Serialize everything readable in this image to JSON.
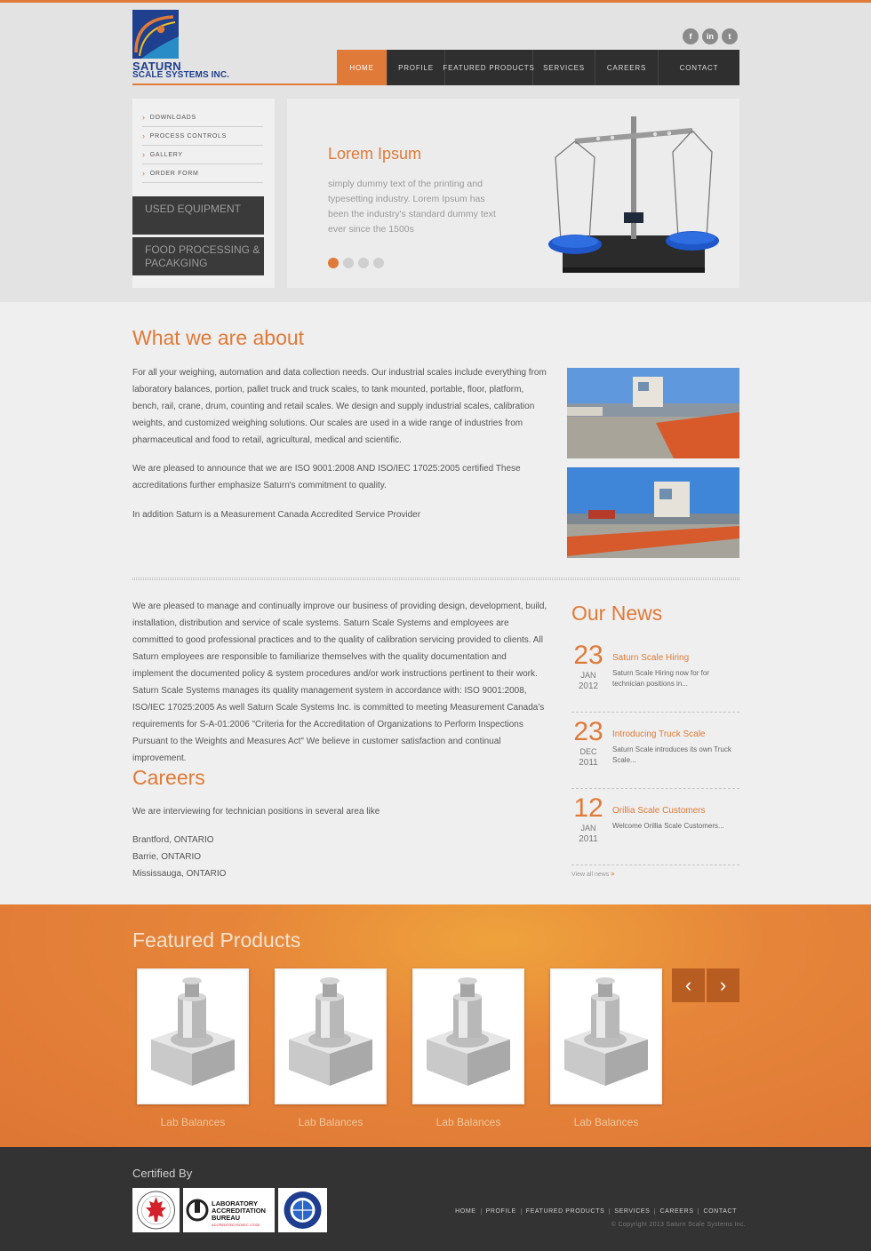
{
  "brand": {
    "name_line1": "SATURN",
    "name_line2": "SCALE SYSTEMS INC.",
    "colors": {
      "accent": "#e07a38",
      "logo_blue": "#1f3f8f",
      "dark": "#2f2f2f"
    }
  },
  "social": [
    {
      "icon": "facebook-icon",
      "glyph": "f"
    },
    {
      "icon": "linkedin-icon",
      "glyph": "in"
    },
    {
      "icon": "twitter-icon",
      "glyph": "t"
    }
  ],
  "nav": {
    "items": [
      "HOME",
      "PROFILE",
      "FEATURED PRODUCTS",
      "SERVICES",
      "CAREERS",
      "CONTACT"
    ],
    "active": "HOME"
  },
  "sidebar": {
    "links": [
      "DOWNLOADS",
      "PROCESS CONTROLS",
      "GALLERY",
      "ORDER FORM"
    ],
    "boxes": [
      "USED EQUIPMENT",
      "FOOD PROCESSING & PACAKGING"
    ]
  },
  "hero": {
    "title": "Lorem Ipsum",
    "text": "simply dummy text of the printing and typesetting industry. Lorem Ipsum has been the industry's standard dummy text ever since the 1500s",
    "slides_total": 4,
    "slide_active": 1
  },
  "about": {
    "title": "What we are about",
    "p1": "For all your weighing, automation and data collection needs. Our industrial scales include everything from laboratory balances, portion, pallet truck and truck scales, to tank mounted, portable, floor, platform, bench, rail, crane, drum, counting and retail scales. We design and supply industrial scales, calibration weights, and customized weighing solutions. Our scales are used in a wide range of industries from pharmaceutical and food to retail, agricultural, medical and scientific.",
    "p2": "We are pleased to announce that we are ISO 9001:2008 AND ISO/IEC 17025:2005 certified These accreditations further emphasize Saturn's commitment to quality.",
    "p3": "In addition Saturn is a Measurement Canada Accredited Service Provider"
  },
  "quality": {
    "text": "We are pleased to manage and continually improve our business of providing design, development, build, installation, distribution and service of scale systems. Saturn Scale Systems and employees are committed to good professional practices and to the quality of calibration servicing provided to clients. All Saturn employees are responsible to familiarize themselves with the quality documentation and implement the documented policy & system procedures and/or work instructions pertinent to their work. Saturn Scale Systems manages its quality management system in accordance with: ISO 9001:2008, ISO/IEC 17025:2005 As well Saturn Scale Systems Inc. is committed to meeting Measurement Canada's requirements for S-A-01:2006 \"Criteria for the Accreditation of Organizations to Perform Inspections Pursuant to the Weights and Measures Act\" We believe in customer satisfaction and continual improvement."
  },
  "careers": {
    "title": "Careers",
    "intro": "We are interviewing for technician positions in several area like",
    "locations": [
      "Brantford, ONTARIO",
      "Barrie, ONTARIO",
      "Mississauga, ONTARIO"
    ]
  },
  "news": {
    "title": "Our News",
    "items": [
      {
        "day": "23",
        "month": "JAN",
        "year": "2012",
        "headline": "Saturn Scale Hiring",
        "body": "Saturn Scale Hiring now for for technician positions in..."
      },
      {
        "day": "23",
        "month": "DEC",
        "year": "2011",
        "headline": "Introducing Truck Scale",
        "body": "Saturn Scale introduces its own Truck Scale..."
      },
      {
        "day": "12",
        "month": "JAN",
        "year": "2011",
        "headline": "Orillia Scale Customers",
        "body": "Welcome Orillia Scale Customers..."
      }
    ],
    "view_all": "View all news",
    "view_all_arrow": ">"
  },
  "featured": {
    "title": "Featured Products",
    "products": [
      "Lab Balances",
      "Lab Balances",
      "Lab Balances",
      "Lab Balances"
    ],
    "prev_glyph": "‹",
    "next_glyph": "›"
  },
  "footer": {
    "certified_title": "Certified By",
    "cert_logos": {
      "lab_line1": "LABORATORY",
      "lab_line2": "ACCREDITATION",
      "lab_line3": "BUREAU",
      "lab_line4": "ACCREDITED ISO/IEC 17025"
    },
    "nav": [
      "HOME",
      "PROFILE",
      "FEATURED PRODUCTS",
      "SERVICES",
      "CAREERS",
      "CONTACT"
    ],
    "copyright": "© Copyright 2013 Saturn Scale Systems Inc."
  }
}
